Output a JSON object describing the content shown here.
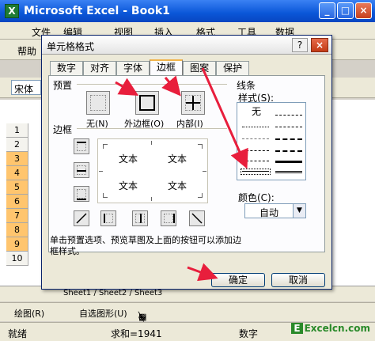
{
  "app": {
    "title": "Microsoft Excel - Book1",
    "logo": "X"
  },
  "menu": {
    "items": [
      "文件",
      "编辑",
      "视图",
      "插入",
      "格式",
      "工具",
      "数据"
    ]
  },
  "toolbar": {
    "help": "帮助"
  },
  "format_bar": {
    "font_value": "宋体"
  },
  "rows": [
    "1",
    "2",
    "3",
    "4",
    "5",
    "6",
    "7",
    "8",
    "9",
    "10"
  ],
  "sheet_tabs": {
    "text": "Sheet1 / Sheet2 / Sheet3"
  },
  "draw_toolbar": {
    "draw_label": "绘图(R)",
    "autoshape_label": "自选图形(U)"
  },
  "status_bar": {
    "left": "就绪",
    "sum": "求和=1941",
    "mode": "数字"
  },
  "watermark": {
    "e": "E",
    "text": "Excelcn.com"
  },
  "dialog": {
    "title": "单元格格式",
    "help_btn": "?",
    "close_btn": "×",
    "tabs": [
      "数字",
      "对齐",
      "字体",
      "边框",
      "图案",
      "保护"
    ],
    "active_tab": "边框",
    "presets_label": "预置",
    "presets": [
      {
        "label": "无(N)"
      },
      {
        "label": "外边框(O)"
      },
      {
        "label": "内部(I)"
      }
    ],
    "border_label": "边框",
    "preview_texts": [
      "文本",
      "文本",
      "文本",
      "文本"
    ],
    "line_label": "线条",
    "style_label": "样式(S):",
    "none_style": "无",
    "color_label": "颜色(C):",
    "color_value": "自动",
    "hint": "单击预置选项、预览草图及上面的按钮可以添加边框样式。",
    "ok_label": "确定",
    "cancel_label": "取消",
    "arrow_color": "#e81e3c"
  }
}
